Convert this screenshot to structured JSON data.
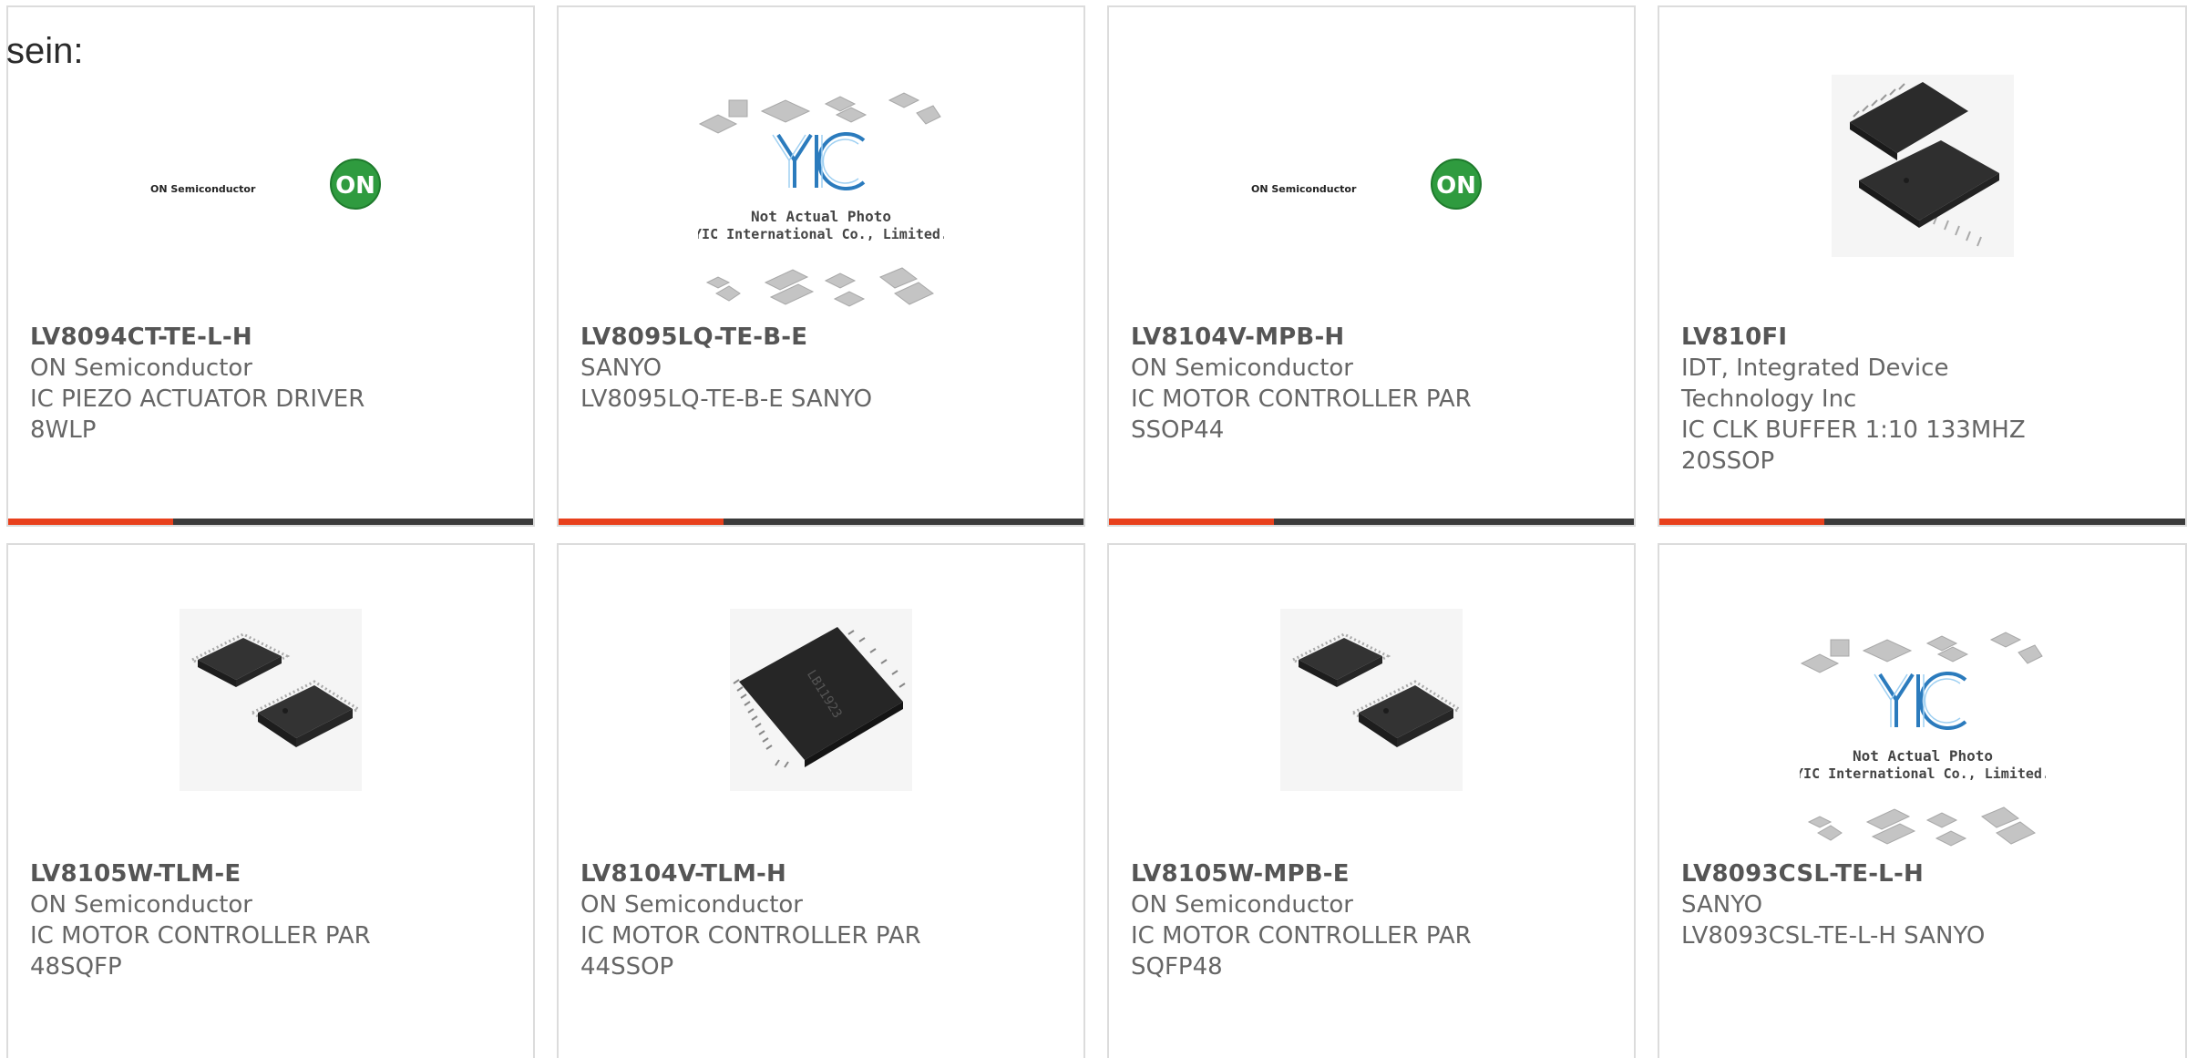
{
  "intro_text": "sein:",
  "colors": {
    "accent": "#e8401c",
    "bar": "#3b3b3b",
    "border": "#dcdcdc",
    "text": "#666666"
  },
  "products": [
    {
      "part_number": "LV8094CT-TE-L-H",
      "manufacturer": "ON Semiconductor",
      "description": "IC PIEZO ACTUATOR DRIVER 8WLP",
      "image": "on-semiconductor-logo"
    },
    {
      "part_number": "LV8095LQ-TE-B-E",
      "manufacturer": "SANYO",
      "description": "LV8095LQ-TE-B-E SANYO",
      "image": "yic-not-actual-photo",
      "image_text": {
        "line1": "Not Actual Photo",
        "line2": "YIC International Co., Limited."
      }
    },
    {
      "part_number": "LV8104V-MPB-H",
      "manufacturer": "ON Semiconductor",
      "description": "IC MOTOR CONTROLLER PAR SSOP44",
      "image": "on-semiconductor-logo"
    },
    {
      "part_number": "LV810FI",
      "manufacturer": "IDT, Integrated Device Technology Inc",
      "description": "IC CLK BUFFER 1:10 133MHZ 20SSOP",
      "image": "ssop-chip-photo"
    },
    {
      "part_number": "LV8105W-TLM-E",
      "manufacturer": "ON Semiconductor",
      "description": "IC MOTOR CONTROLLER PAR 48SQFP",
      "image": "qfp-chip-photo"
    },
    {
      "part_number": "LV8104V-TLM-H",
      "manufacturer": "ON Semiconductor",
      "description": "IC MOTOR CONTROLLER PAR 44SSOP",
      "image": "ssop-chip-photo",
      "chip_marking": "LB11923"
    },
    {
      "part_number": "LV8105W-MPB-E",
      "manufacturer": "ON Semiconductor",
      "description": "IC MOTOR CONTROLLER PAR SQFP48",
      "image": "qfp-chip-photo"
    },
    {
      "part_number": "LV8093CSL-TE-L-H",
      "manufacturer": "SANYO",
      "description": "LV8093CSL-TE-L-H SANYO",
      "image": "yic-not-actual-photo",
      "image_text": {
        "line1": "Not Actual Photo",
        "line2": "YIC International Co., Limited."
      }
    }
  ],
  "logo_text": {
    "on_semi": "ON Semiconductor",
    "on": "ON"
  }
}
